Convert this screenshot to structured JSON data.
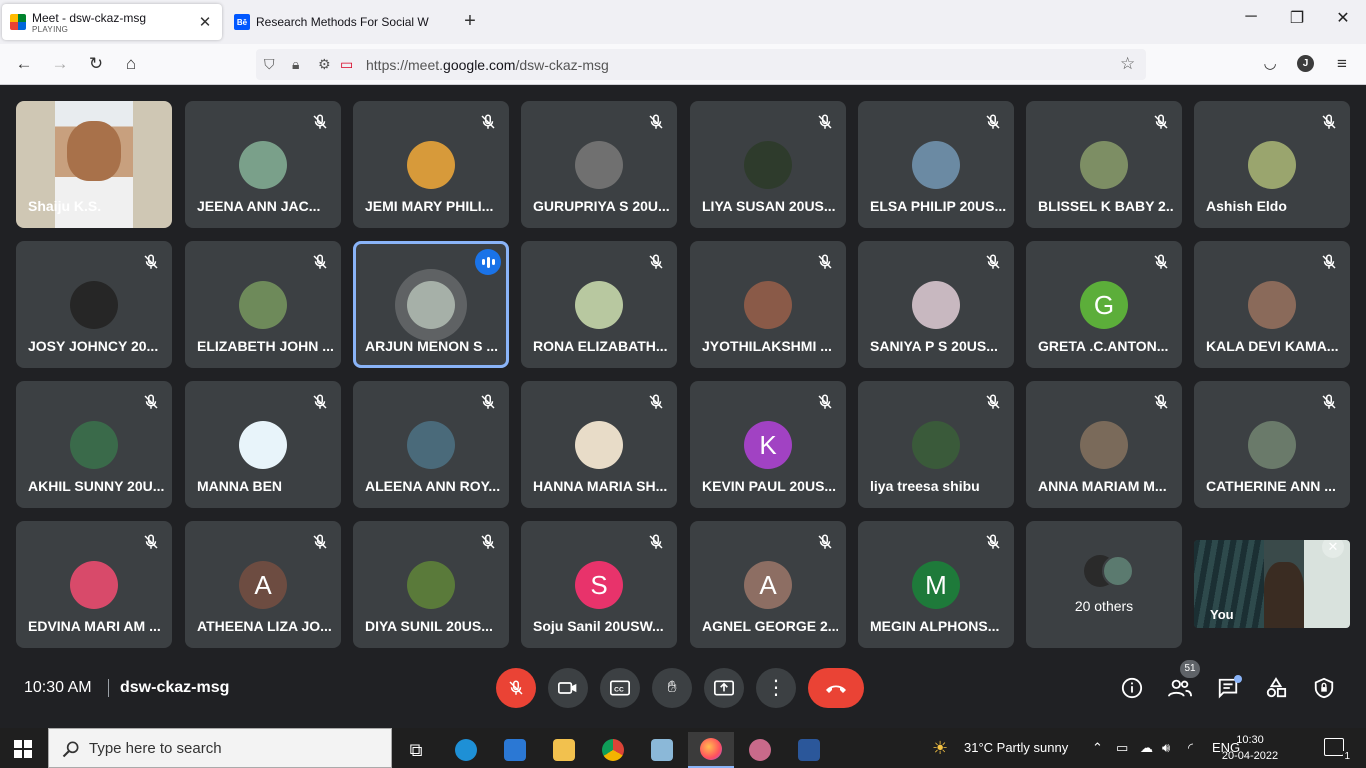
{
  "browser": {
    "tabs": [
      {
        "title": "Meet - dsw-ckaz-msg",
        "subtitle": "PLAYING"
      },
      {
        "title": "Research Methods For Social W"
      }
    ],
    "new_tab": "+",
    "url_host": "https://meet.",
    "url_domain": "google.com",
    "url_path": "/dsw-ckaz-msg",
    "profile_initial": "J"
  },
  "meet": {
    "participants": [
      {
        "name": "Shaiju K.S.",
        "type": "video"
      },
      {
        "name": "JEENA ANN JAC...",
        "color": "#7aa08a"
      },
      {
        "name": "JEMI MARY PHILI...",
        "color": "#d79a3a"
      },
      {
        "name": "GURUPRIYA S 20U...",
        "color": "#707070"
      },
      {
        "name": "LIYA SUSAN 20US...",
        "color": "#2e3b2c"
      },
      {
        "name": "ELSA PHILIP 20US...",
        "color": "#6b8aa3"
      },
      {
        "name": "BLISSEL K BABY 2...",
        "color": "#7d8e64"
      },
      {
        "name": "Ashish Eldo",
        "color": "#9aa56e"
      },
      {
        "name": "JOSY JOHNCY 20...",
        "color": "#262626"
      },
      {
        "name": "ELIZABETH JOHN ...",
        "color": "#6e8a5a"
      },
      {
        "name": "ARJUN MENON S ...",
        "color": "#a6b0a8",
        "speaking": true
      },
      {
        "name": "RONA ELIZABATH...",
        "color": "#b8c8a0"
      },
      {
        "name": "JYOTHILAKSHMI ...",
        "color": "#8a5a48"
      },
      {
        "name": "SANIYA P S 20US...",
        "color": "#c8b8c0"
      },
      {
        "name": "GRETA .C.ANTON...",
        "initial": "G",
        "color": "#5cae3a"
      },
      {
        "name": "KALA DEVI KAMA...",
        "color": "#8a6a5a"
      },
      {
        "name": "AKHIL SUNNY 20U...",
        "color": "#3a6a4a"
      },
      {
        "name": "MANNA BEN",
        "color": "#e8f4fa"
      },
      {
        "name": "ALEENA ANN ROY...",
        "color": "#4a6a7a"
      },
      {
        "name": "HANNA MARIA SH...",
        "color": "#e8dcc8"
      },
      {
        "name": "KEVIN PAUL 20US...",
        "initial": "K",
        "color": "#a142c3"
      },
      {
        "name": "liya treesa shibu",
        "color": "#3a5a3a"
      },
      {
        "name": "ANNA MARIAM M...",
        "color": "#7a6a5a"
      },
      {
        "name": "CATHERINE ANN ...",
        "color": "#6a7a6a"
      },
      {
        "name": "EDVINA MARI AM ...",
        "color": "#d84a6a"
      },
      {
        "name": "ATHEENA LIZA JO...",
        "initial": "A",
        "color": "#6d4c41"
      },
      {
        "name": "DIYA SUNIL 20US...",
        "color": "#5a7a3a"
      },
      {
        "name": "Soju Sanil 20USW...",
        "initial": "S",
        "color": "#e8336b"
      },
      {
        "name": "AGNEL GEORGE 2...",
        "initial": "A",
        "color": "#8d6e63"
      },
      {
        "name": "MEGIN ALPHONS...",
        "initial": "M",
        "color": "#1e7a3a"
      }
    ],
    "others_label": "20 others",
    "self_label": "You",
    "time": "10:30 AM",
    "meeting_code": "dsw-ckaz-msg",
    "people_count": "51"
  },
  "taskbar": {
    "search_placeholder": "Type here to search",
    "weather": "31°C  Partly sunny",
    "language": "ENG",
    "clock_time": "10:30",
    "clock_date": "20-04-2022",
    "notifications": "1"
  }
}
